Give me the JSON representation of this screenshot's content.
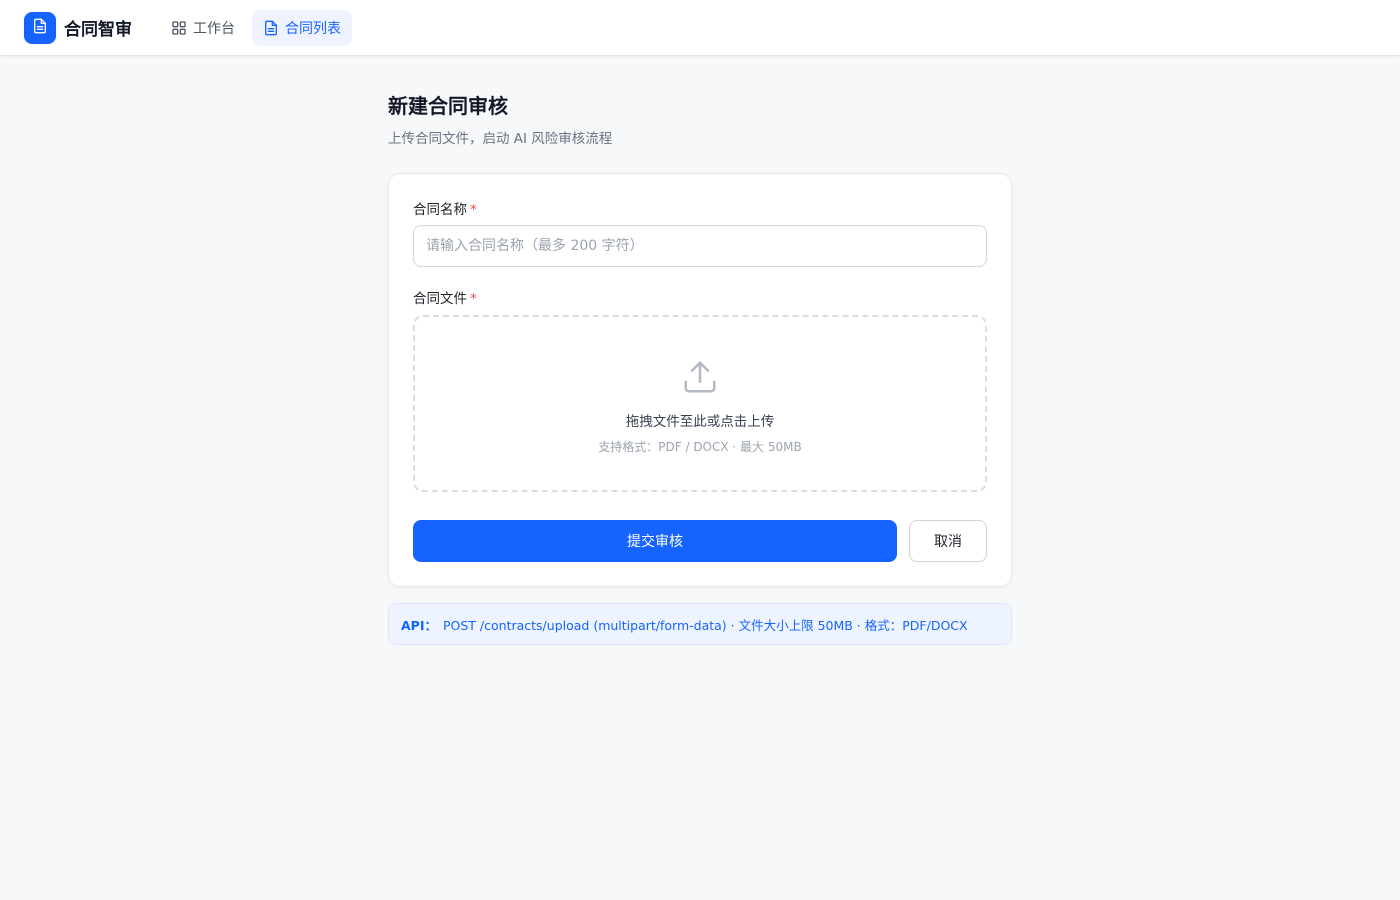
{
  "brand": {
    "name": "合同智审",
    "logo_icon": "document-icon"
  },
  "nav": [
    {
      "label": "工作台",
      "icon": "grid-icon",
      "active": false
    },
    {
      "label": "合同列表",
      "icon": "document-icon",
      "active": true
    }
  ],
  "page": {
    "title": "新建合同审核",
    "subtitle": "上传合同文件，启动 AI 风险审核流程"
  },
  "form": {
    "name_field": {
      "label": "合同名称",
      "required_mark": "*",
      "value": "",
      "placeholder": "请输入合同名称（最多 200 字符）"
    },
    "file_field": {
      "label": "合同文件",
      "required_mark": "*",
      "upload_icon": "upload-icon",
      "drop_text": "拖拽文件至此或点击上传",
      "hint": "支持格式：PDF / DOCX · 最大 50MB"
    },
    "submit_label": "提交审核",
    "cancel_label": "取消"
  },
  "api_note": {
    "label": "API：",
    "text": "POST /contracts/upload (multipart/form-data) · 文件大小上限 50MB · 格式：PDF/DOCX"
  },
  "colors": {
    "primary": "#1664ff",
    "background": "#f7f8fa",
    "required": "#e5484d",
    "api_note_bg": "#eef4ff"
  }
}
